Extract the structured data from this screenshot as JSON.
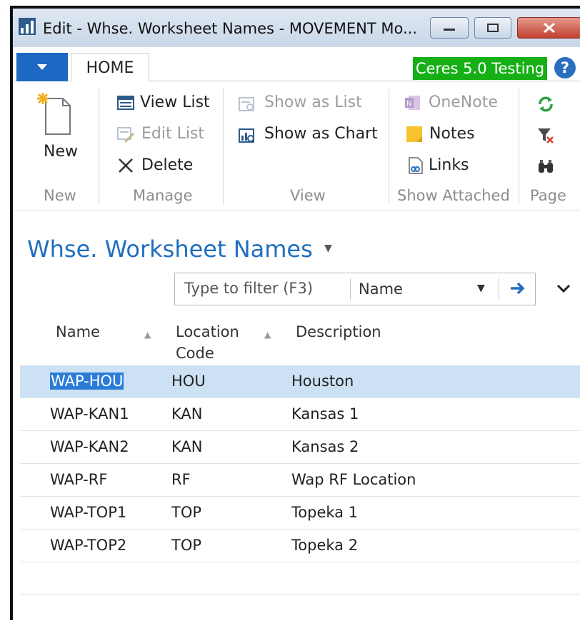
{
  "window": {
    "title": "Edit - Whse. Worksheet Names - MOVEMENT Mo...",
    "minimize_glyph": "▭",
    "maximize_glyph": "▢",
    "close_glyph": "✖"
  },
  "ribbon": {
    "tab": "HOME",
    "environment_badge": "Ceres 5.0 Testing",
    "help_glyph": "?",
    "new_label": "New",
    "view_list_label": "View List",
    "edit_list_label": "Edit List",
    "delete_label": "Delete",
    "show_as_list_label": "Show as List",
    "show_as_chart_label": "Show as Chart",
    "onenote_label": "OneNote",
    "notes_label": "Notes",
    "links_label": "Links",
    "groups": {
      "new": "New",
      "manage": "Manage",
      "view": "View",
      "show_attached": "Show Attached",
      "page": "Page"
    }
  },
  "page": {
    "title": "Whse. Worksheet Names",
    "filter_placeholder": "Type to filter (F3)",
    "filter_field": "Name"
  },
  "table": {
    "headers": {
      "name": "Name",
      "location_line1": "Location",
      "location_line2": "Code",
      "description": "Description"
    },
    "rows": [
      {
        "name": "WAP-HOU",
        "location": "HOU",
        "description": "Houston"
      },
      {
        "name": "WAP-KAN1",
        "location": "KAN",
        "description": "Kansas 1"
      },
      {
        "name": "WAP-KAN2",
        "location": "KAN",
        "description": "Kansas 2"
      },
      {
        "name": "WAP-RF",
        "location": "RF",
        "description": "Wap RF Location"
      },
      {
        "name": "WAP-TOP1",
        "location": "TOP",
        "description": "Topeka 1"
      },
      {
        "name": "WAP-TOP2",
        "location": "TOP",
        "description": "Topeka 2"
      }
    ]
  },
  "colors": {
    "accent": "#1f6fc0",
    "selected_row": "#cde1f5",
    "badge": "#16b016"
  }
}
